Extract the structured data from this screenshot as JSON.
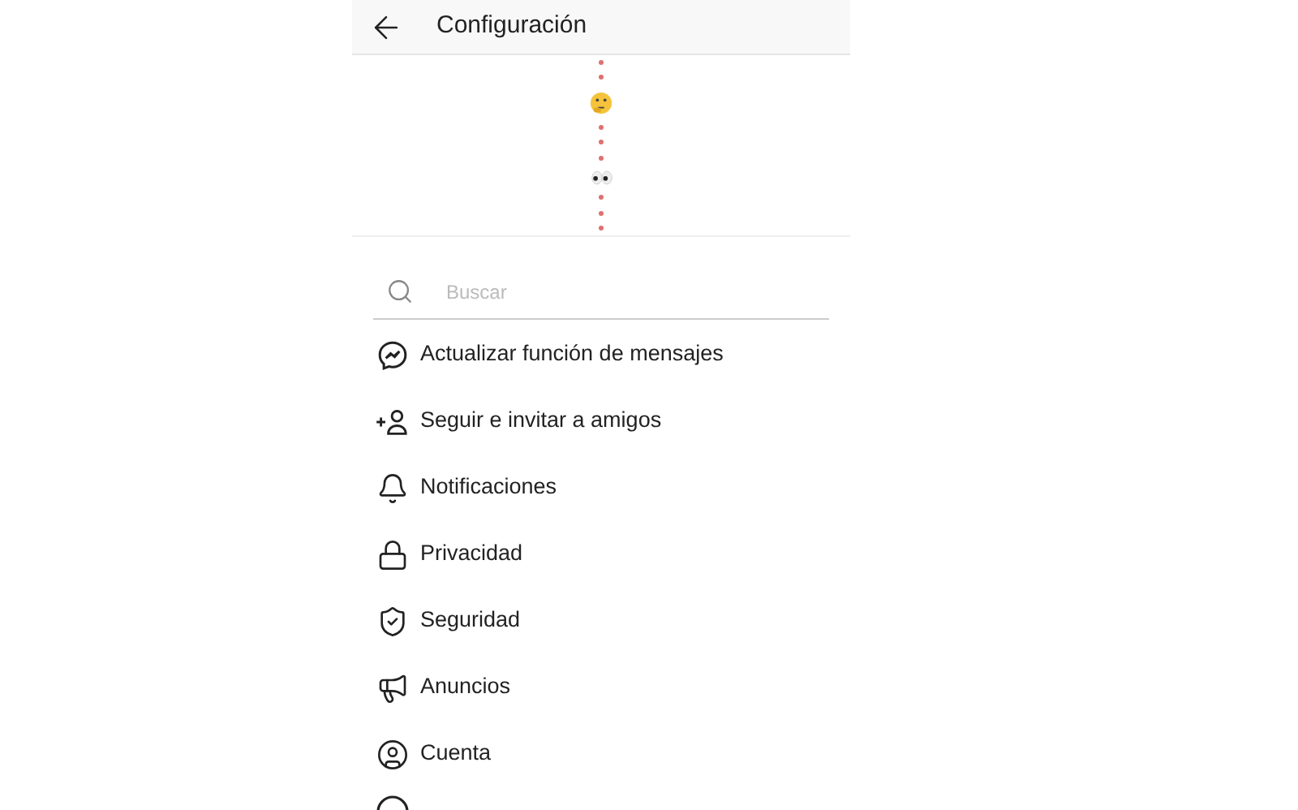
{
  "header": {
    "title": "Configuración"
  },
  "search": {
    "placeholder": "Buscar"
  },
  "items": [
    {
      "kind": "messenger",
      "label": "Actualizar función de mensajes"
    },
    {
      "kind": "follow",
      "label": "Seguir e invitar a amigos"
    },
    {
      "kind": "bell",
      "label": "Notificaciones"
    },
    {
      "kind": "lock",
      "label": "Privacidad"
    },
    {
      "kind": "shield",
      "label": "Seguridad"
    },
    {
      "kind": "megaphone",
      "label": "Anuncios"
    },
    {
      "kind": "account",
      "label": "Cuenta"
    }
  ]
}
